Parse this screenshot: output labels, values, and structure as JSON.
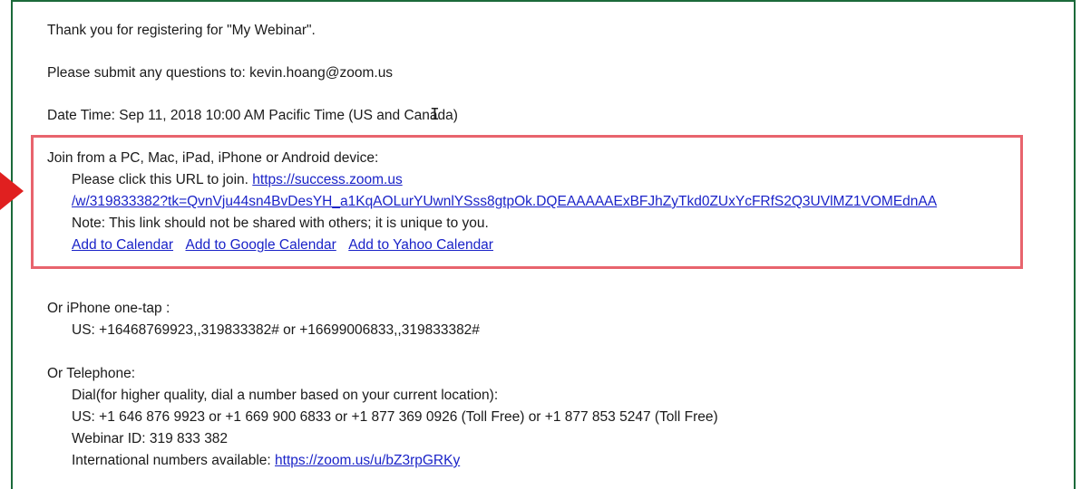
{
  "email": {
    "thanks": "Thank you for registering for \"My Webinar\".",
    "questions": "Please submit any questions to: kevin.hoang@zoom.us",
    "datetime": "Date Time: Sep 11, 2018 10:00 AM Pacific Time (US and Canada)",
    "join_heading": "Join from a PC, Mac, iPad, iPhone or Android device:",
    "click_prefix": "Please click this URL to join.",
    "join_url_line1": "https://success.zoom.us",
    "join_url_line2": "/w/319833382?tk=QvnVju44sn4BvDesYH_a1KqAOLurYUwnlYSss8gtpOk.DQEAAAAAExBFJhZyTkd0ZUxYcFRfS2Q3UVlMZ1VOMEdnAA",
    "note": "Note: This link should not be shared with others; it is unique to you.",
    "calendar_links": [
      "Add to Calendar",
      "Add to Google Calendar",
      "Add to Yahoo Calendar"
    ],
    "iphone_heading": "Or iPhone one-tap :",
    "iphone_numbers": "US: +16468769923,,319833382# or +16699006833,,319833382#",
    "telephone_heading": "Or Telephone:",
    "dial_note": "Dial(for higher quality, dial a number based on your current location):",
    "us_numbers": "US: +1 646 876 9923 or +1 669 900 6833 or +1 877 369 0926 (Toll Free) or +1 877 853 5247 (Toll Free)",
    "webinar_id": "Webinar ID: 319 833 382",
    "intl_prefix": "International numbers available:",
    "intl_url": "https://zoom.us/u/bZ3rpGRKy"
  },
  "colors": {
    "frame_border": "#1b6a3a",
    "highlight_border": "#e8646d",
    "arrow": "#e02020",
    "link": "#1a23c8"
  },
  "icons": {
    "cursor": "text-cursor-icon",
    "pointer": "red-arrow-icon"
  }
}
